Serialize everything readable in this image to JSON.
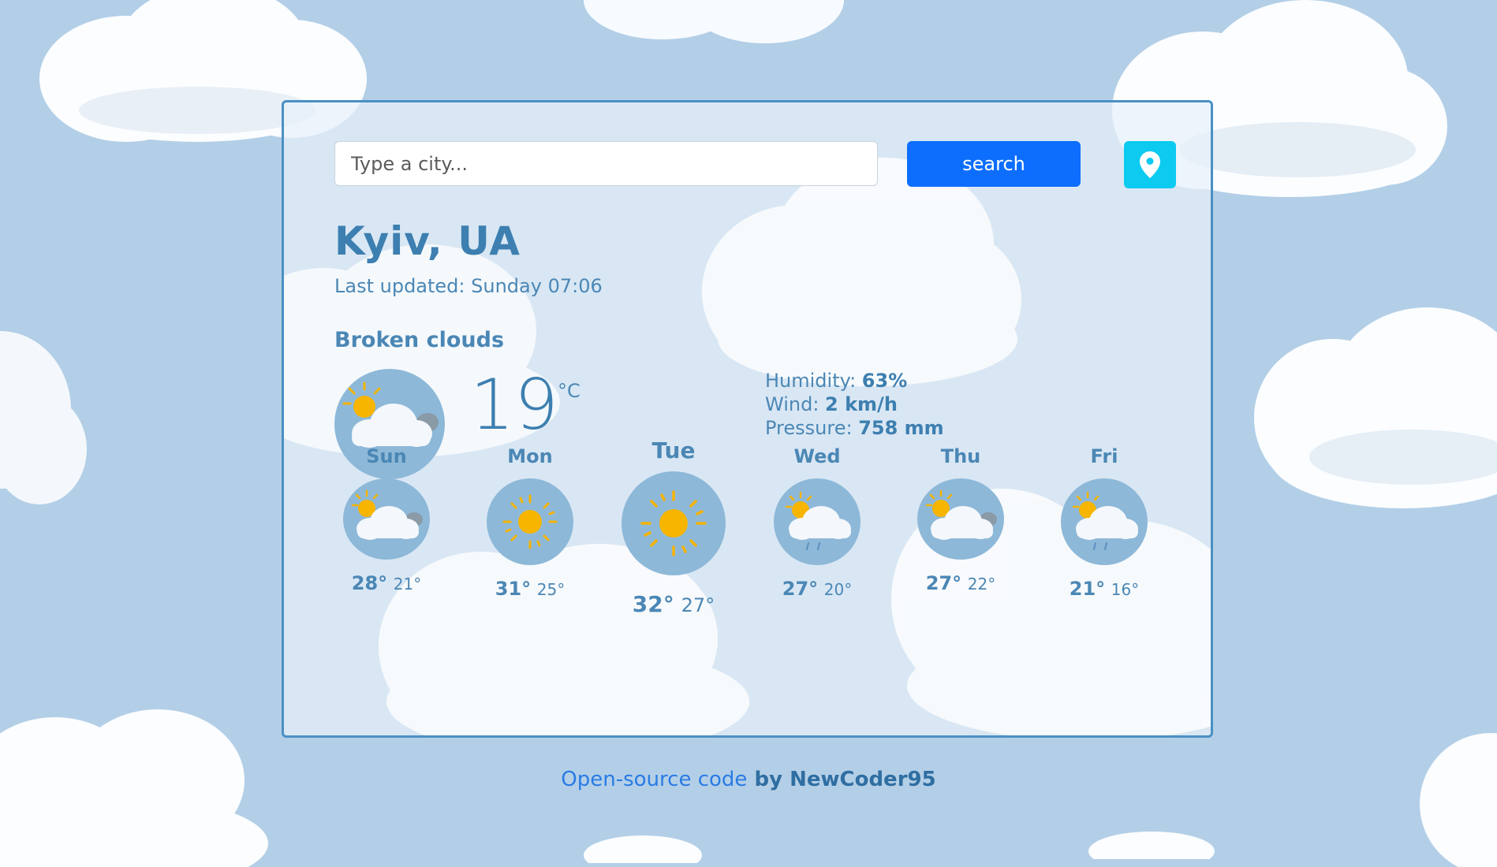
{
  "search": {
    "placeholder": "Type a city...",
    "button_label": "search"
  },
  "location_button": {
    "icon": "location-pin-icon"
  },
  "city": "Kyiv, UA",
  "last_updated": "Last updated: Sunday 07:06",
  "description": "Broken clouds",
  "current": {
    "icon": "sun-behind-cloud-icon",
    "temperature": "19",
    "unit": "°C",
    "stats": [
      {
        "label": "Humidity: ",
        "value": "63%"
      },
      {
        "label": "Wind: ",
        "value": "2 km/h"
      },
      {
        "label": "Pressure: ",
        "value": "758 mm"
      }
    ]
  },
  "forecast": [
    {
      "day": "Sun",
      "icon": "sun-behind-cloud-icon",
      "max": "28°",
      "min": "21°"
    },
    {
      "day": "Mon",
      "icon": "sun-icon",
      "max": "31°",
      "min": "25°"
    },
    {
      "day": "Tue",
      "icon": "sun-icon",
      "max": "32°",
      "min": "27°"
    },
    {
      "day": "Wed",
      "icon": "sun-cloud-rain-icon",
      "max": "27°",
      "min": "20°"
    },
    {
      "day": "Thu",
      "icon": "sun-behind-cloud-icon",
      "max": "27°",
      "min": "22°"
    },
    {
      "day": "Fri",
      "icon": "sun-cloud-rain-icon",
      "max": "21°",
      "min": "16°"
    }
  ],
  "footer": {
    "link_text": "Open-source code",
    "by_text": " by ",
    "author": "NewCoder95"
  },
  "colors": {
    "background": "#b3cfe7",
    "accent": "#3d7fb0",
    "search_button": "#0d6efd",
    "location_button": "#0dcaf0"
  }
}
